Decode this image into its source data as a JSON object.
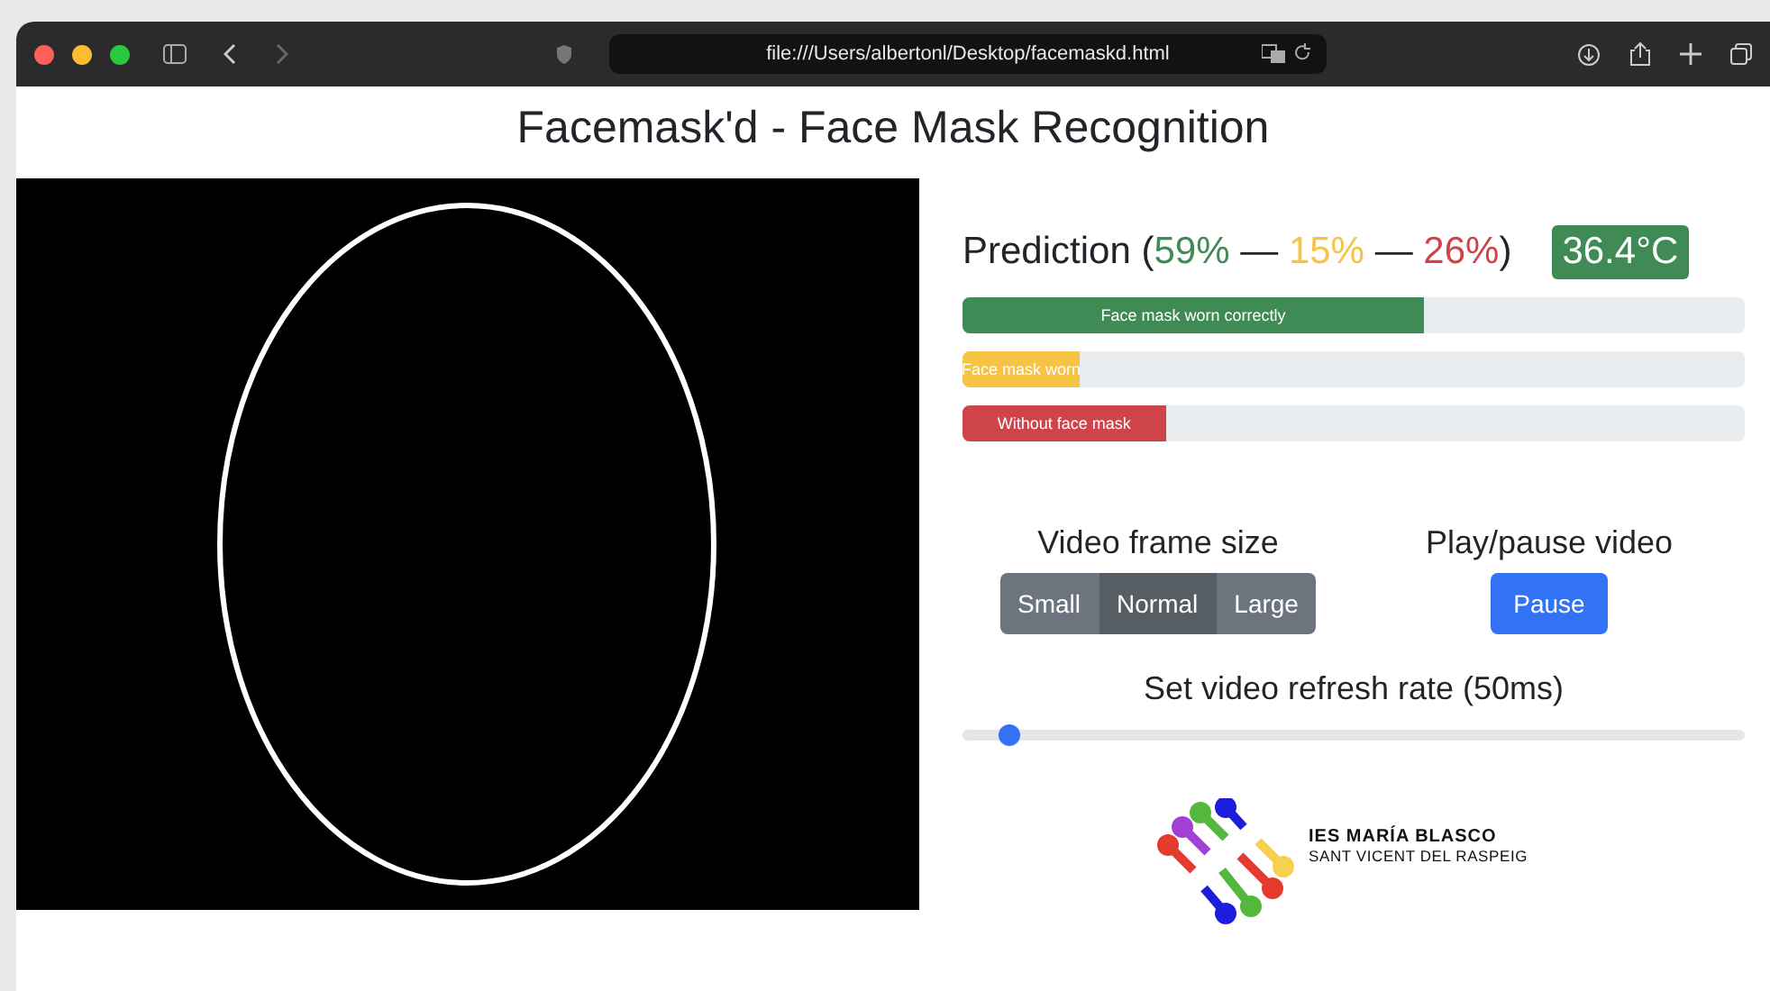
{
  "browser": {
    "url": "file:///Users/albertonl/Desktop/facemaskd.html"
  },
  "page_title": "Facemask'd - Face Mask Recognition",
  "prediction": {
    "label": "Prediction",
    "open": "(",
    "close": ")",
    "parts": [
      {
        "text": "59%",
        "color": "#3f8a55"
      },
      {
        "text": "15%",
        "color": "#f6c344"
      },
      {
        "text": "26%",
        "color": "#cf434a"
      }
    ],
    "separator": "—",
    "temperature": "36.4°C"
  },
  "bars": [
    {
      "label": "Face mask worn correctly",
      "level": 0.59,
      "color": "#3f8a55"
    },
    {
      "label": "Face mask worn",
      "level": 0.15,
      "color": "#f6c344"
    },
    {
      "label": "Without face mask",
      "level": 0.26,
      "color": "#cf434a"
    }
  ],
  "frame_size": {
    "heading": "Video frame size",
    "options": [
      {
        "label": "Small",
        "selected": false
      },
      {
        "label": "Normal",
        "selected": true
      },
      {
        "label": "Large",
        "selected": false
      }
    ]
  },
  "playback": {
    "heading": "Play/pause video",
    "button": "Pause"
  },
  "refresh": {
    "heading": "Set video refresh rate (50ms)",
    "level": 0.06
  },
  "logo": {
    "name": "IES MARÍA BLASCO",
    "place": "SANT VICENT DEL RASPEIG"
  }
}
